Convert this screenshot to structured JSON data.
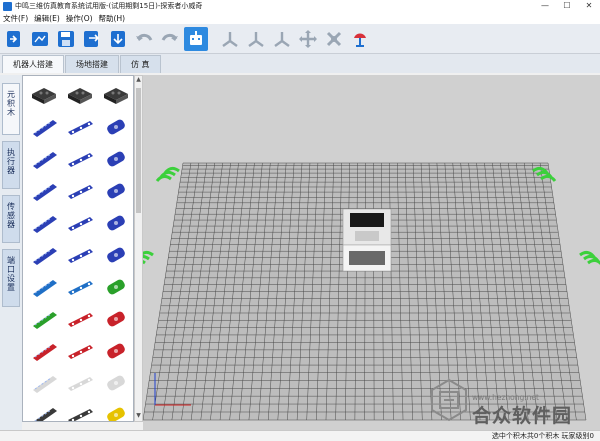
{
  "window": {
    "title": "中鸣三维仿真教育系统试用版-(试用期剩15日)-探索者小威奇",
    "minimize": "—",
    "maximize": "☐",
    "close": "✕"
  },
  "menu": [
    "文件(F)",
    "编辑(E)",
    "操作(O)",
    "帮助(H)"
  ],
  "toolbar": {
    "buttons": [
      "import-icon",
      "open-icon",
      "save-icon",
      "save-as-icon",
      "export-icon",
      "undo-icon",
      "redo-icon",
      "robot-icon",
      "move-x-icon",
      "move-y-icon",
      "move-z-icon",
      "move-all-icon",
      "rotate-icon",
      "paint-icon"
    ],
    "accent": "#1e6fd0"
  },
  "tabs": [
    "机器人搭建",
    "场地搭建",
    "仿 真"
  ],
  "side_tabs": [
    {
      "label": "元积木"
    },
    {
      "label": "执行器"
    },
    {
      "label": "传感器"
    },
    {
      "label": "端口设置"
    }
  ],
  "palette": {
    "part_count": 33,
    "part_colors": [
      "#3a3a3a",
      "#2b3fb5",
      "#1f6fc6",
      "#2aa02a",
      "#c8222a",
      "#d8d8d8",
      "#e6c200"
    ]
  },
  "scene": {
    "floor_color": "#bdbdbd",
    "grid_line_color": "#4a4a4a",
    "boundary_color": "#3cd03c"
  },
  "watermark": {
    "url": "www.hezhong.net",
    "text": "合众软件园"
  },
  "status": {
    "text": "选中个积木共0个积木 玩家级别0"
  }
}
